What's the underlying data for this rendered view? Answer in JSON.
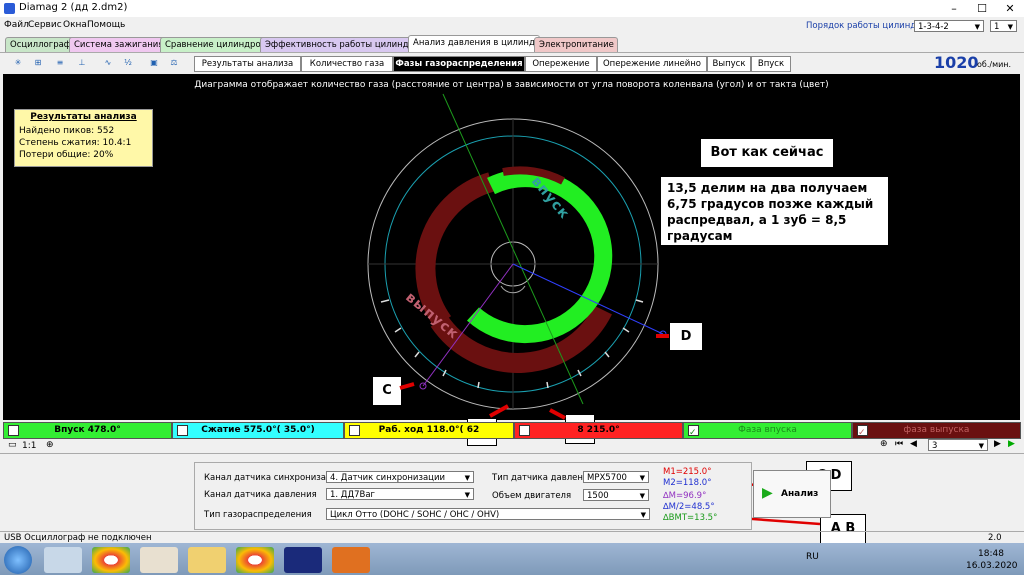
{
  "window": {
    "title": "Diamag 2 (дд 2.dm2)"
  },
  "menu": [
    "Файл",
    "Сервис",
    "Окна",
    "Помощь"
  ],
  "cylinder_order": {
    "label": "Порядок работы цилиндров",
    "value": "1-3-4-2",
    "cylinder": "1"
  },
  "tabs": [
    {
      "label": "Осциллограф",
      "color": "#c8e6c8"
    },
    {
      "label": "Система зажигания",
      "color": "#f0c8f0"
    },
    {
      "label": "Сравнение цилиндров",
      "color": "#c8f0c8"
    },
    {
      "label": "Эффективность работы цилиндров",
      "color": "#d8c8f0"
    },
    {
      "label": "Анализ давления в цилиндре",
      "color": "#ffffff"
    },
    {
      "label": "Электропитание",
      "color": "#f0c8c8"
    }
  ],
  "toolbar_icons": [
    "sensor-icon",
    "osc-icon",
    "auto-icon",
    "graph-icon",
    "wave-icon",
    "algorithm-icon",
    "save-icon",
    "scale-icon"
  ],
  "subtabs": [
    "Результаты анализа",
    "Количество газа",
    "Фазы газораспределения",
    "Опережение",
    "Опережение линейно",
    "Выпуск",
    "Впуск"
  ],
  "rpm": {
    "value": "1020",
    "unit": "об./мин."
  },
  "diagram_title": "Диаграмма отображает количество газа (расстояние от центра) в зависимости от угла поворота коленвала (угол) и от такта (цвет)",
  "results": {
    "title": "Результаты анализа",
    "peaks": "Найдено пиков: 552",
    "compression": "Степень сжатия: 10.4:1",
    "losses": "Потери общие: 20%"
  },
  "annotations": {
    "note1": "Вот как сейчас",
    "note2": "13,5 делим на два получаем 6,75 градусов позже каждый распредвал, а 1 зуб = 8,5 градусам",
    "A": "A",
    "B": "B",
    "C": "C",
    "D": "D",
    "CD": "C D",
    "AB": "A B"
  },
  "ring_labels": {
    "intake": "впуск",
    "exhaust": "выпуск"
  },
  "phases": [
    {
      "label": "Впуск 478.0°",
      "color": "#33ee33"
    },
    {
      "label": "Сжатие 575.0°( 35.0°)",
      "color": "#33ffff"
    },
    {
      "label": "Раб. ход 118.0°( 62",
      "color": "#ffff00"
    },
    {
      "label": "8   215.0°",
      "color": "#ff2222"
    },
    {
      "label": "Фаза впуска",
      "color": "#33ee33"
    },
    {
      "label": "фаза выпуска",
      "color": "#6a1010"
    }
  ],
  "scale": "1:1",
  "page": {
    "value": "3"
  },
  "settings": {
    "sync_label": "Канал датчика синхронизации",
    "sync_value": "4. Датчик синхронизации",
    "pressure_label": "Канал датчика давления",
    "pressure_value": "1. ДД7Ваг",
    "timing_label": "Тип газораспределения",
    "timing_value": "Цикл Отто (DOHC / SOHC / OHC / OHV)",
    "sensor_type_label": "Тип датчика давления",
    "sensor_type_value": "MPX5700",
    "engine_volume_label": "Объем двигателя",
    "engine_volume_value": "1500"
  },
  "markers": {
    "m1": "M1=215.0°",
    "m2": "M2=118.0°",
    "dm": "∆M=96.9°",
    "dm2": "∆M/2=48.5°",
    "dbmt": "∆ВМТ=13.5°"
  },
  "analyze_button": "Анализ",
  "statusbar": {
    "left": "USB Осциллограф не подключен",
    "right": "2.0"
  },
  "taskbar": {
    "lang": "RU",
    "time": "18:48",
    "date": "16.03.2020"
  }
}
